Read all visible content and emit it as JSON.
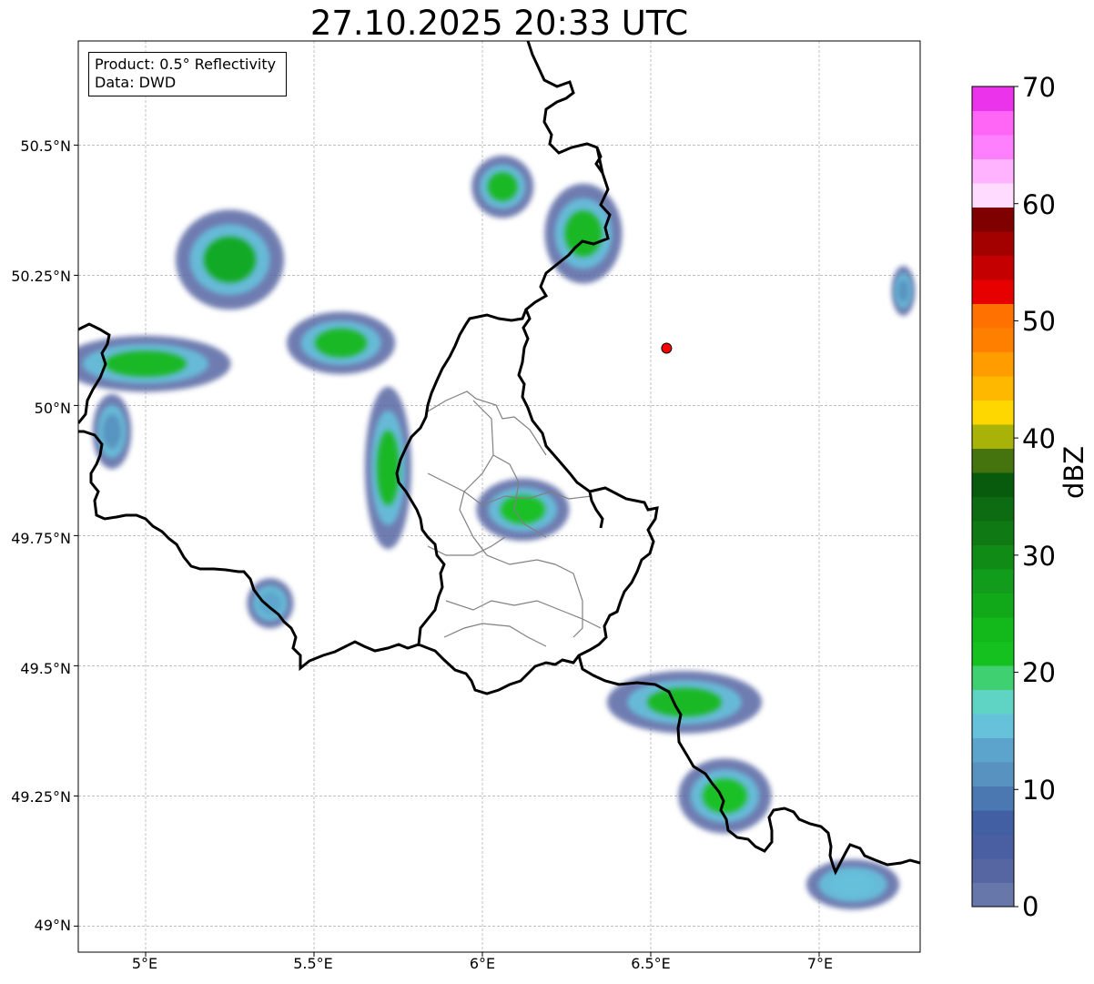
{
  "title": "27.10.2025 20:33 UTC",
  "info_box": {
    "product": "Product: 0.5° Reflectivity",
    "data": "Data: DWD"
  },
  "axes": {
    "lat_ticks": [
      {
        "value": 50.5,
        "label": "50.5°N"
      },
      {
        "value": 50.25,
        "label": "50.25°N"
      },
      {
        "value": 50.0,
        "label": "50°N"
      },
      {
        "value": 49.75,
        "label": "49.75°N"
      },
      {
        "value": 49.5,
        "label": "49.5°N"
      },
      {
        "value": 49.25,
        "label": "49.25°N"
      },
      {
        "value": 49.0,
        "label": "49°N"
      }
    ],
    "lon_ticks": [
      {
        "value": 5.0,
        "label": "5°E"
      },
      {
        "value": 5.5,
        "label": "5.5°E"
      },
      {
        "value": 6.0,
        "label": "6°E"
      },
      {
        "value": 6.5,
        "label": "6.5°E"
      },
      {
        "value": 7.0,
        "label": "7°E"
      }
    ],
    "lon_range": [
      4.8,
      7.3
    ],
    "lat_range": [
      48.95,
      50.7
    ],
    "grid": true
  },
  "colorbar": {
    "unit": "dBZ",
    "range": [
      0,
      70
    ],
    "tick_labels": [
      {
        "value": 0,
        "label": "0"
      },
      {
        "value": 10,
        "label": "10"
      },
      {
        "value": 20,
        "label": "20"
      },
      {
        "value": 30,
        "label": "30"
      },
      {
        "value": 40,
        "label": "40"
      },
      {
        "value": 50,
        "label": "50"
      },
      {
        "value": 60,
        "label": "60"
      },
      {
        "value": 70,
        "label": "70"
      }
    ],
    "colors": [
      "#6777a9",
      "#5666a3",
      "#4a5fa2",
      "#435fa4",
      "#4b78b1",
      "#5892c0",
      "#5da4cc",
      "#66c1db",
      "#5fd4c4",
      "#3fd171",
      "#14c11f",
      "#13b81b",
      "#11a91a",
      "#129c1c",
      "#108b15",
      "#0f7a14",
      "#0d6b12",
      "#085a0d",
      "#45740f",
      "#a8b209",
      "#ffd700",
      "#ffb800",
      "#ff9c00",
      "#ff8000",
      "#ff7100",
      "#e60000",
      "#c40000",
      "#a30000",
      "#7f0000",
      "#ffdcff",
      "#ffb3ff",
      "#ff80ff",
      "#ff66f5",
      "#eb33eb"
    ]
  },
  "radar_site": {
    "lon": 6.547,
    "lat": 50.11,
    "color": "#ff0000"
  },
  "echoes": [
    {
      "lon": 5.0,
      "lat": 50.08,
      "rx": 0.22,
      "ry": 0.045,
      "dbz": 24
    },
    {
      "lon": 5.25,
      "lat": 50.28,
      "rx": 0.14,
      "ry": 0.08,
      "dbz": 26
    },
    {
      "lon": 5.58,
      "lat": 50.12,
      "rx": 0.14,
      "ry": 0.05,
      "dbz": 23
    },
    {
      "lon": 5.72,
      "lat": 49.88,
      "rx": 0.06,
      "ry": 0.13,
      "dbz": 23
    },
    {
      "lon": 6.12,
      "lat": 49.8,
      "rx": 0.12,
      "ry": 0.05,
      "dbz": 22
    },
    {
      "lon": 6.06,
      "lat": 50.42,
      "rx": 0.08,
      "ry": 0.05,
      "dbz": 24
    },
    {
      "lon": 6.3,
      "lat": 50.33,
      "rx": 0.1,
      "ry": 0.08,
      "dbz": 23
    },
    {
      "lon": 6.6,
      "lat": 49.43,
      "rx": 0.2,
      "ry": 0.05,
      "dbz": 24
    },
    {
      "lon": 6.72,
      "lat": 49.25,
      "rx": 0.12,
      "ry": 0.06,
      "dbz": 22
    },
    {
      "lon": 7.1,
      "lat": 49.08,
      "rx": 0.12,
      "ry": 0.04,
      "dbz": 16
    },
    {
      "lon": 5.37,
      "lat": 49.62,
      "rx": 0.06,
      "ry": 0.04,
      "dbz": 14
    },
    {
      "lon": 4.9,
      "lat": 49.95,
      "rx": 0.05,
      "ry": 0.06,
      "dbz": 12
    },
    {
      "lon": 7.25,
      "lat": 50.22,
      "rx": 0.03,
      "ry": 0.04,
      "dbz": 12
    }
  ]
}
